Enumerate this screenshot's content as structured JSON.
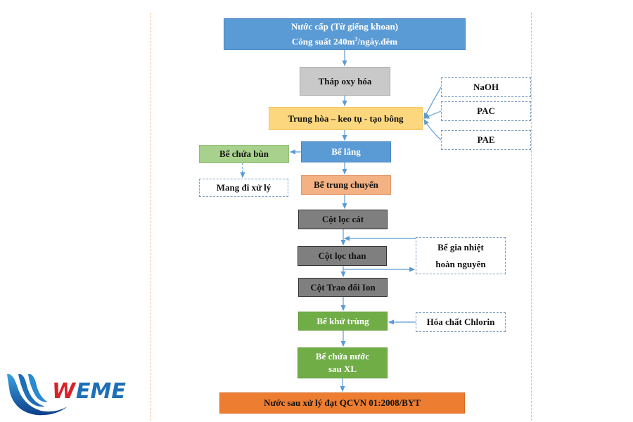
{
  "steps": {
    "source_line1": "Nước cấp (Từ giếng khoan)",
    "source_line2_prefix": "Công suất 240m",
    "source_line2_sup": "3",
    "source_line2_suffix": "/ngày.đêm",
    "oxidation": "Tháp oxy hóa",
    "coagulation": "Trung hòa – keo tụ - tạo bông",
    "settling": "Bể lắng",
    "sludge": "Bể chứa bùn",
    "sludge_disposal": "Mang đi xử lý",
    "transfer": "Bể trung chuyển",
    "sand_filter": "Cột lọc cát",
    "carbon_filter": "Cột lọc than",
    "regeneration_line1": "Bể gia nhiệt",
    "regeneration_line2": "hoàn nguyên",
    "ion_exchange": "Cột Trao đổi Ion",
    "disinfection": "Bể khử trùng",
    "chlorine": "Hóa chất Chlorin",
    "storage_line1": "Bể chứa nước",
    "storage_line2": "sau XL",
    "output": "Nước sau xử lý đạt QCVN 01:2008/BYT"
  },
  "chemicals": [
    "NaOH",
    "PAC",
    "PAE"
  ],
  "logo_text": "WEME",
  "colors": {
    "blue": "#5b9bd5",
    "yellow": "#fdd77e",
    "green": "#70ad47",
    "orange": "#ed7d31",
    "arrow": "#5b9bd5"
  }
}
